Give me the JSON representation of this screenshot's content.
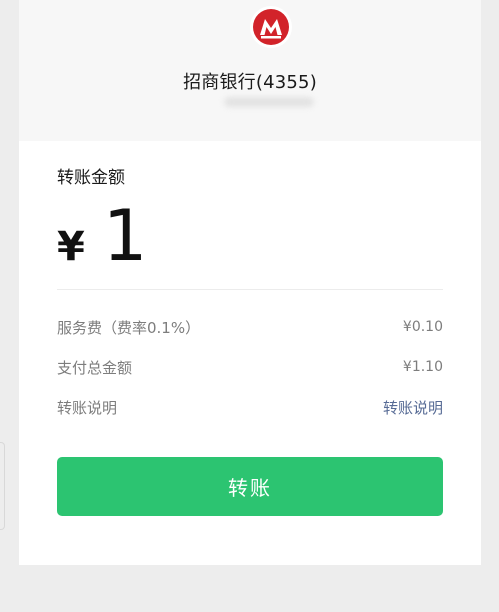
{
  "header": {
    "bank_logo_icon": "china-merchants-bank-logo-icon",
    "bank_name": "招商银行(4355)"
  },
  "transfer": {
    "amount_label": "转账金额",
    "currency_symbol": "¥",
    "amount": "1",
    "fee_label": "服务费（费率0.1%）",
    "fee_value": "¥0.10",
    "total_label": "支付总金额",
    "total_value": "¥1.10",
    "note_label": "转账说明",
    "note_link": "转账说明",
    "button_label": "转账"
  },
  "colors": {
    "brand_red": "#d2232a",
    "button_green": "#2cc471",
    "link_blue": "#576b95"
  }
}
